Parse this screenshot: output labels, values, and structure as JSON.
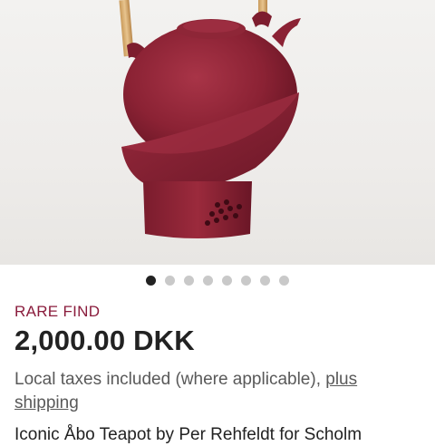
{
  "listing": {
    "badge": "RARE FIND",
    "price": "2,000.00 DKK",
    "tax_note": "Local taxes included (where applicable),",
    "shipping_link": "plus shipping",
    "title": "Iconic Åbo Teapot by Per Rehfeldt for Scholm"
  },
  "gallery": {
    "image_count": 8,
    "active_index": 0
  },
  "colors": {
    "badge": "#8a1c3c",
    "teapot": "#8b2234",
    "dot_active": "#222222",
    "dot_inactive": "#c9c9c9"
  }
}
